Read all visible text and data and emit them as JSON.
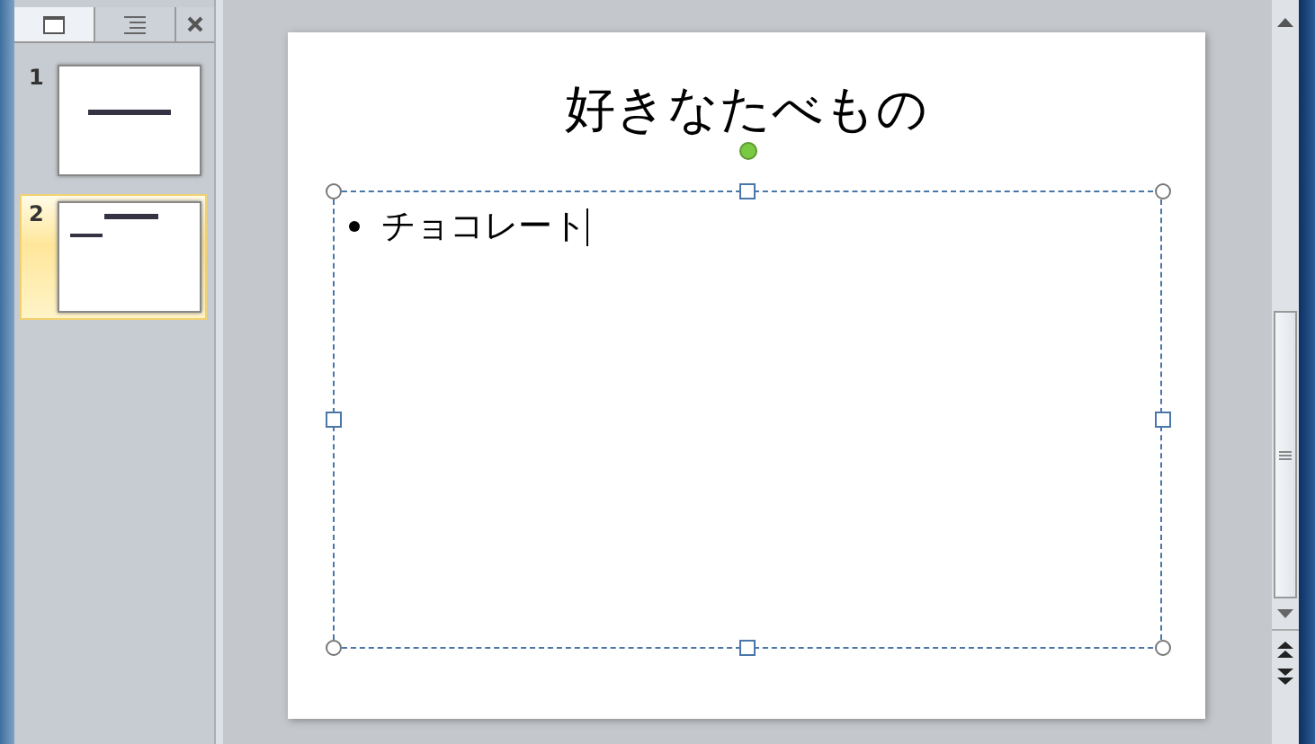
{
  "pane_tabs": [
    {
      "kind": "slides",
      "selected": true
    },
    {
      "kind": "outline",
      "selected": false
    }
  ],
  "thumbnails": [
    {
      "number": "1",
      "selected": false,
      "kind": "title"
    },
    {
      "number": "2",
      "selected": true,
      "kind": "content"
    }
  ],
  "slide": {
    "title": "好きなたべもの",
    "bullets": [
      "チョコレート"
    ]
  }
}
